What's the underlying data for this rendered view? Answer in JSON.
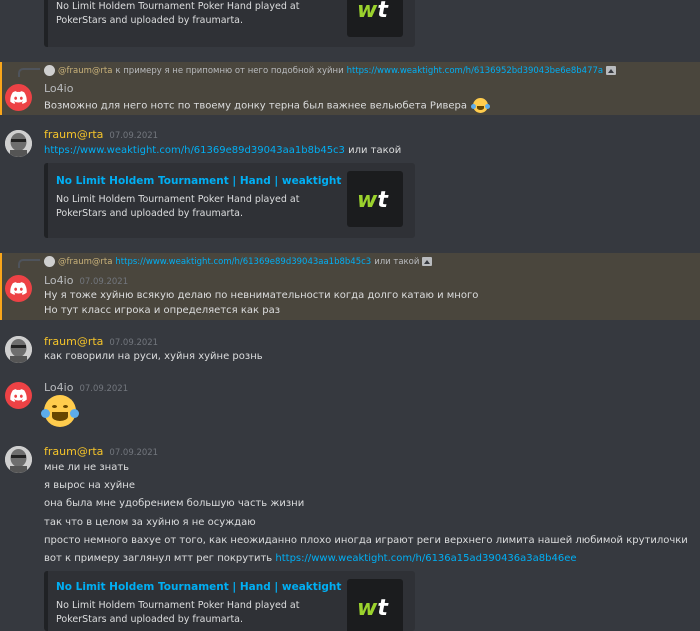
{
  "messages": {
    "embed_top": {
      "desc": "No Limit Holdem Tournament Poker Hand played at PokerStars and uploaded by fraumarta."
    },
    "m1": {
      "reply_mention": "@fraum@rta",
      "reply_text": "к примеру я не припомню от него подобной хуйни",
      "reply_link": "https://www.weaktight.com/h/6136952bd39043be6e8b477a",
      "author": "Lo4io",
      "text": "Возможно для него нотс по твоему донку терна был важнее вельюбета Ривера"
    },
    "m2": {
      "author": "fraum@rta",
      "time": "07.09.2021",
      "link": "https://www.weaktight.com/h/61369e89d39043aa1b8b45c3",
      "suffix": "или такой",
      "embed_title": "No Limit Holdem Tournament | Hand | weaktight",
      "embed_desc": "No Limit Holdem Tournament Poker Hand played at PokerStars and uploaded by fraumarta."
    },
    "m3": {
      "reply_mention": "@fraum@rta",
      "reply_link": "https://www.weaktight.com/h/61369e89d39043aa1b8b45c3",
      "reply_suffix": "или такой",
      "author": "Lo4io",
      "time": "07.09.2021",
      "line1": "Ну я тоже хуйню всякую делаю по невнимательности когда долго катаю и много",
      "line2": "Но тут класс игрока и определяется как раз"
    },
    "m4": {
      "author": "fraum@rta",
      "time": "07.09.2021",
      "text": "как говорили на руси, хуйня хуйне рознь"
    },
    "m5": {
      "author": "Lo4io",
      "time": "07.09.2021"
    },
    "m6": {
      "author": "fraum@rta",
      "time": "07.09.2021",
      "lines": [
        "мне ли не знать",
        "я вырос на хуйне",
        "она была мне удобрением большую часть жизни",
        "так что в целом за хуйню я не осуждаю",
        "просто немного вахуе от того, как неожиданно плохо иногда играют реги верхнего лимита нашей любимой крутилочки"
      ],
      "last_prefix": "вот к примеру заглянул мтт рег покрутить",
      "last_link": "https://www.weaktight.com/h/6136a15ad390436a3a8b46ee",
      "embed_title": "No Limit Holdem Tournament | Hand | weaktight",
      "embed_desc": "No Limit Holdem Tournament Poker Hand played at PokerStars and uploaded by fraumarta."
    }
  },
  "thumb_logo": "wt",
  "colors": {
    "bg": "#36393f",
    "link": "#00aff4",
    "fraum": "#f5c42a",
    "highlight": "#4a463d",
    "discord_red": "#ed4245"
  }
}
